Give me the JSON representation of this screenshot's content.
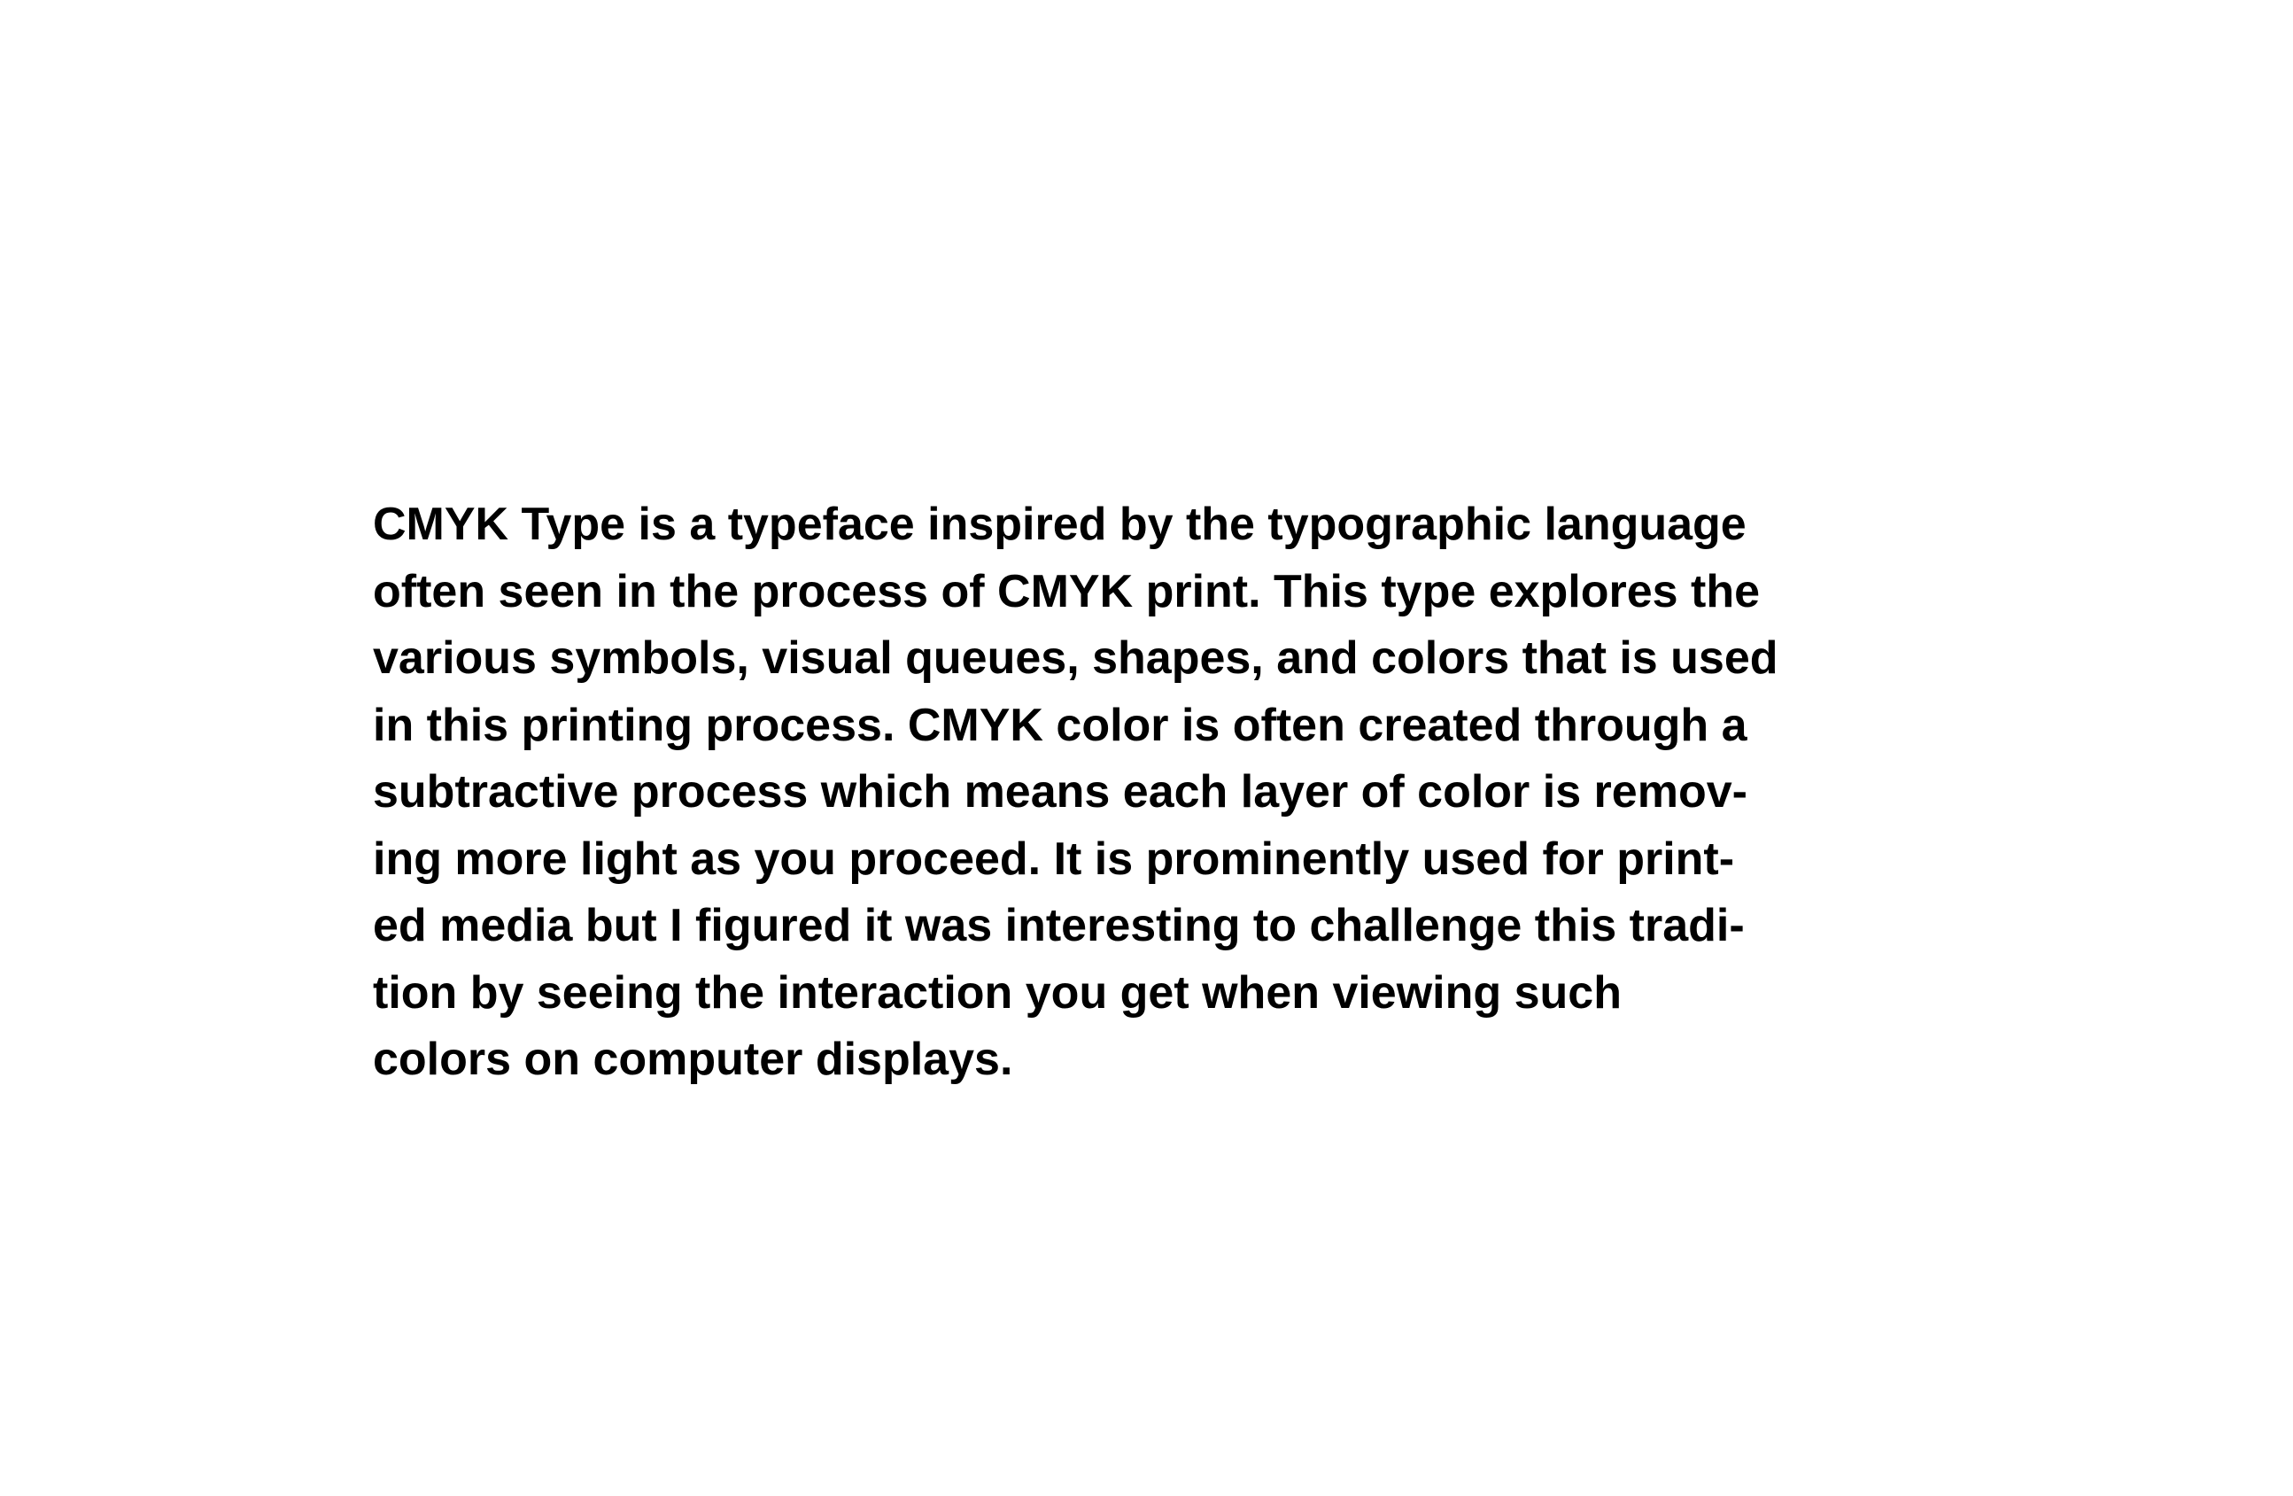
{
  "body": {
    "lines": [
      "CMYK Type is a typeface inspired by the typographic language",
      "often seen in the process of CMYK print. This type explores the",
      "various symbols, visual queues, shapes, and colors that is used",
      "in this printing process. CMYK color is often created through a",
      "subtractive process which means each layer of color is remov-",
      "ing more light as you proceed. It is prominently used for print-",
      "ed media but I figured it was interesting to challenge this tradi-",
      "tion by seeing the interaction you get when viewing such",
      "colors on computer displays."
    ]
  }
}
